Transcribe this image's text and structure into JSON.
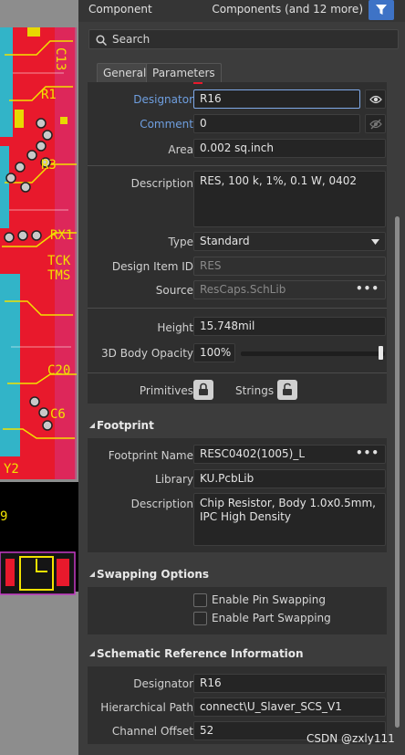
{
  "canvas": {
    "labels": [
      "C13",
      "R1",
      "R3",
      "RX1",
      "TCK",
      "TMS",
      "C20",
      "C6",
      "Y2"
    ]
  },
  "header": {
    "title": "Component",
    "scope": "Components (and 12 more)"
  },
  "search": {
    "placeholder": "Search"
  },
  "tabs": [
    {
      "label": "General",
      "active": true
    },
    {
      "label": "Parameters",
      "active": false
    }
  ],
  "properties": {
    "designator": {
      "label": "Designator",
      "value": "R16"
    },
    "comment": {
      "label": "Comment",
      "value": "0"
    },
    "area": {
      "label": "Area",
      "value": "0.002 sq.inch"
    },
    "description": {
      "label": "Description",
      "value": "RES, 100 k, 1%, 0.1 W, 0402"
    },
    "type": {
      "label": "Type",
      "value": "Standard"
    },
    "design_item_id": {
      "label": "Design Item ID",
      "value": "RES"
    },
    "source": {
      "label": "Source",
      "value": "ResCaps.SchLib"
    },
    "height": {
      "label": "Height",
      "value": "15.748mil"
    },
    "body_opacity": {
      "label": "3D Body Opacity",
      "value": "100%",
      "level": 1.0
    },
    "primitives": {
      "label": "Primitives"
    },
    "strings": {
      "label": "Strings"
    }
  },
  "footprint": {
    "section_title": "Footprint",
    "name": {
      "label": "Footprint Name",
      "value": "RESC0402(1005)_L"
    },
    "library": {
      "label": "Library",
      "value": "KU.PcbLib"
    },
    "description": {
      "label": "Description",
      "value": "Chip Resistor, Body 1.0x0.5mm, IPC High Density"
    }
  },
  "swapping": {
    "section_title": "Swapping Options",
    "pin_swapping": {
      "label": "Enable Pin Swapping",
      "checked": false
    },
    "part_swapping": {
      "label": "Enable Part Swapping",
      "checked": false
    }
  },
  "schematic_ref": {
    "section_title": "Schematic Reference Information",
    "designator": {
      "label": "Designator",
      "value": "R16"
    },
    "hierarchical_path": {
      "label": "Hierarchical Path",
      "value": "connect\\U_Slaver_SCS_V1"
    },
    "channel_offset": {
      "label": "Channel Offset",
      "value": "52"
    }
  },
  "watermark": "CSDN @zxly111",
  "colors": {
    "accent": "#3e73c6",
    "label_blue": "#6f9fe0",
    "panel_bg": "#3c3c3c",
    "group_bg": "#2f2f2f",
    "pcb_red": "#e8192c",
    "pcb_yellow": "#e8d800"
  }
}
